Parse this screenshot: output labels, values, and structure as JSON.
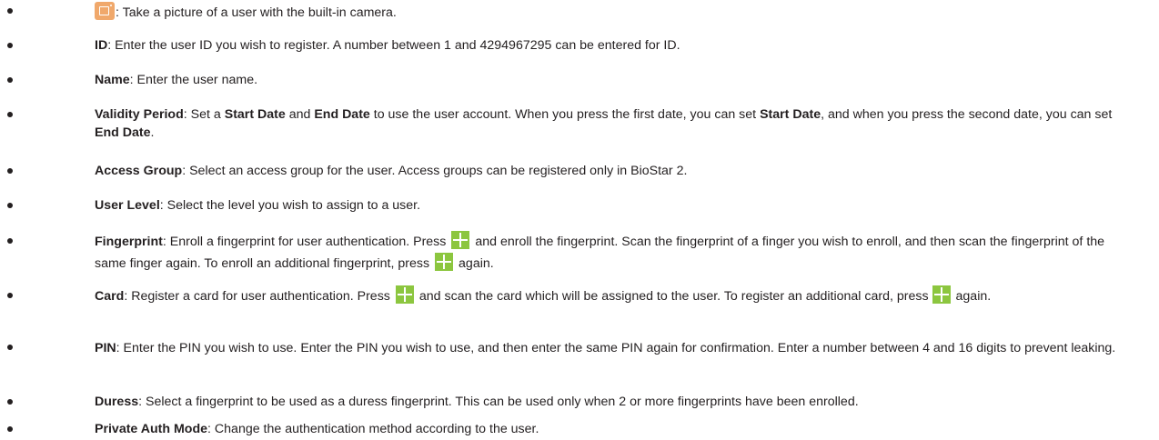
{
  "items": [
    {
      "icon": "camera-icon",
      "text": ": Take a picture of a user with the built-in camera."
    },
    {
      "term": "ID",
      "text": ": Enter the user ID you wish to register. A number between 1 and 4294967295 can be entered for ID."
    },
    {
      "term": "Name",
      "text": ": Enter the user name."
    },
    {
      "term": "Validity Period",
      "parts": [
        ": Set a ",
        "Start Date",
        " and ",
        "End Date",
        " to use the user account. When you press the first date, you can set ",
        "Start Date",
        ", and when you press the second date, you can set ",
        "End Date",
        "."
      ]
    },
    {
      "term": "Access Group",
      "text": ": Select an access group for the user. Access groups can be registered only in BioStar 2."
    },
    {
      "term": "User Level",
      "text": ": Select the level you wish to assign to a user."
    },
    {
      "term": "Fingerprint",
      "parts": [
        ": Enroll a fingerprint for user authentication. Press",
        "and enroll the fingerprint. Scan the fingerprint of a finger you wish to enroll, and then scan the fingerprint of the same finger again. To enroll an additional fingerprint, press",
        "again."
      ]
    },
    {
      "term": "Card",
      "parts": [
        ": Register a card for user authentication. Press",
        "and scan the card which will be assigned to the user. To register an additional card, press",
        "again."
      ]
    },
    {
      "term": "PIN",
      "text": ": Enter the PIN you wish to use. Enter the PIN you wish to use, and then enter the same PIN again for confirmation. Enter a number between 4 and 16 digits to prevent leaking."
    },
    {
      "term": "Duress",
      "text": ": Select a fingerprint to be used as a duress fingerprint. This can be used only when 2 or more fingerprints have been enrolled."
    },
    {
      "term": "Private Auth Mode",
      "text": ": Change the authentication method according to the user."
    }
  ],
  "colors": {
    "text": "#231f20",
    "camera_icon": "#f0a86b",
    "plus_icon": "#8cc63f"
  }
}
